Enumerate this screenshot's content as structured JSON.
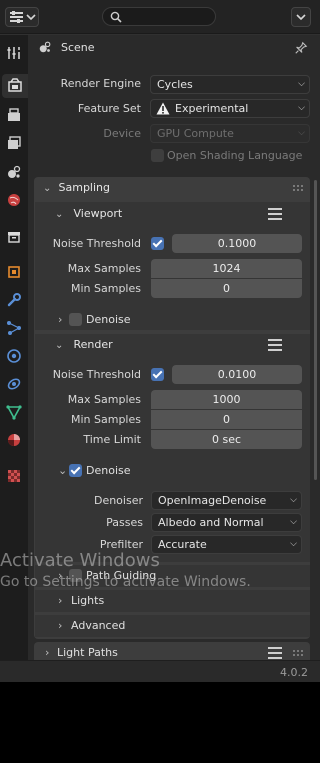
{
  "header": {
    "editor_type_icon": "properties-editor-icon",
    "search_placeholder": "",
    "options_icon": "chevron-down-icon"
  },
  "tabs": [
    {
      "name": "tool",
      "icon": "tool-icon"
    },
    {
      "name": "render",
      "icon": "render-icon",
      "active": true
    },
    {
      "name": "output",
      "icon": "output-icon"
    },
    {
      "name": "view-layer",
      "icon": "view-layer-icon"
    },
    {
      "name": "scene",
      "icon": "scene-icon"
    },
    {
      "name": "world",
      "icon": "world-icon"
    },
    {
      "name": "collection",
      "icon": "collection-icon"
    },
    {
      "name": "object",
      "icon": "object-icon"
    },
    {
      "name": "modifiers",
      "icon": "wrench-icon"
    },
    {
      "name": "particles",
      "icon": "particles-icon"
    },
    {
      "name": "physics",
      "icon": "physics-icon"
    },
    {
      "name": "constraints",
      "icon": "constraints-icon"
    },
    {
      "name": "data",
      "icon": "mesh-data-icon"
    },
    {
      "name": "material",
      "icon": "material-icon"
    },
    {
      "name": "texture",
      "icon": "texture-icon"
    }
  ],
  "context": {
    "label": "Scene"
  },
  "render": {
    "engine_label": "Render Engine",
    "engine_value": "Cycles",
    "feature_set_label": "Feature Set",
    "feature_set_value": "Experimental",
    "device_label": "Device",
    "device_value": "GPU Compute",
    "osl_label": "Open Shading Language"
  },
  "sampling": {
    "title": "Sampling",
    "viewport": {
      "title": "Viewport",
      "noise_threshold_label": "Noise Threshold",
      "noise_threshold_value": "0.1000",
      "max_samples_label": "Max Samples",
      "max_samples_value": "1024",
      "min_samples_label": "Min Samples",
      "min_samples_value": "0",
      "denoise_label": "Denoise"
    },
    "render": {
      "title": "Render",
      "noise_threshold_label": "Noise Threshold",
      "noise_threshold_value": "0.0100",
      "max_samples_label": "Max Samples",
      "max_samples_value": "1000",
      "min_samples_label": "Min Samples",
      "min_samples_value": "0",
      "time_limit_label": "Time Limit",
      "time_limit_value": "0 sec",
      "denoise_label": "Denoise",
      "denoiser_label": "Denoiser",
      "denoiser_value": "OpenImageDenoise",
      "passes_label": "Passes",
      "passes_value": "Albedo and Normal",
      "prefilter_label": "Prefilter",
      "prefilter_value": "Accurate"
    },
    "path_guiding_label": "Path Guiding",
    "lights_label": "Lights",
    "advanced_label": "Advanced"
  },
  "light_paths": {
    "title": "Light Paths"
  },
  "status": {
    "version": "4.0.2"
  },
  "watermark": {
    "line1": "Activate Windows",
    "line2": "Go to Settings to activate Windows."
  },
  "colors": {
    "checkbox_on": "#4772b3",
    "panel_bg": "#3d3d3d",
    "field_bg": "#545454"
  }
}
